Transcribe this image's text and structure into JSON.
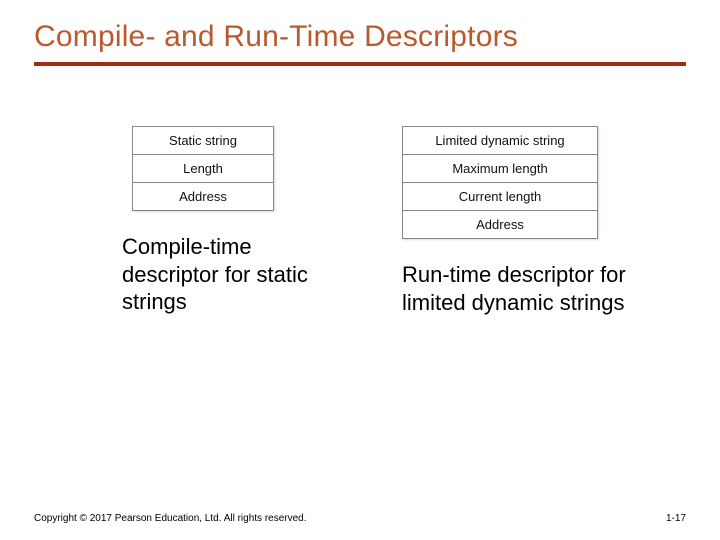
{
  "title": "Compile- and Run-Time Descriptors",
  "left": {
    "rows": [
      "Static string",
      "Length",
      "Address"
    ],
    "caption": "Compile-time descriptor for static strings"
  },
  "right": {
    "rows": [
      "Limited dynamic string",
      "Maximum length",
      "Current length",
      "Address"
    ],
    "caption": "Run-time descriptor for limited dynamic strings"
  },
  "footer": {
    "copyright": "Copyright © 2017 Pearson Education, Ltd. All rights reserved.",
    "page": "1-17"
  }
}
